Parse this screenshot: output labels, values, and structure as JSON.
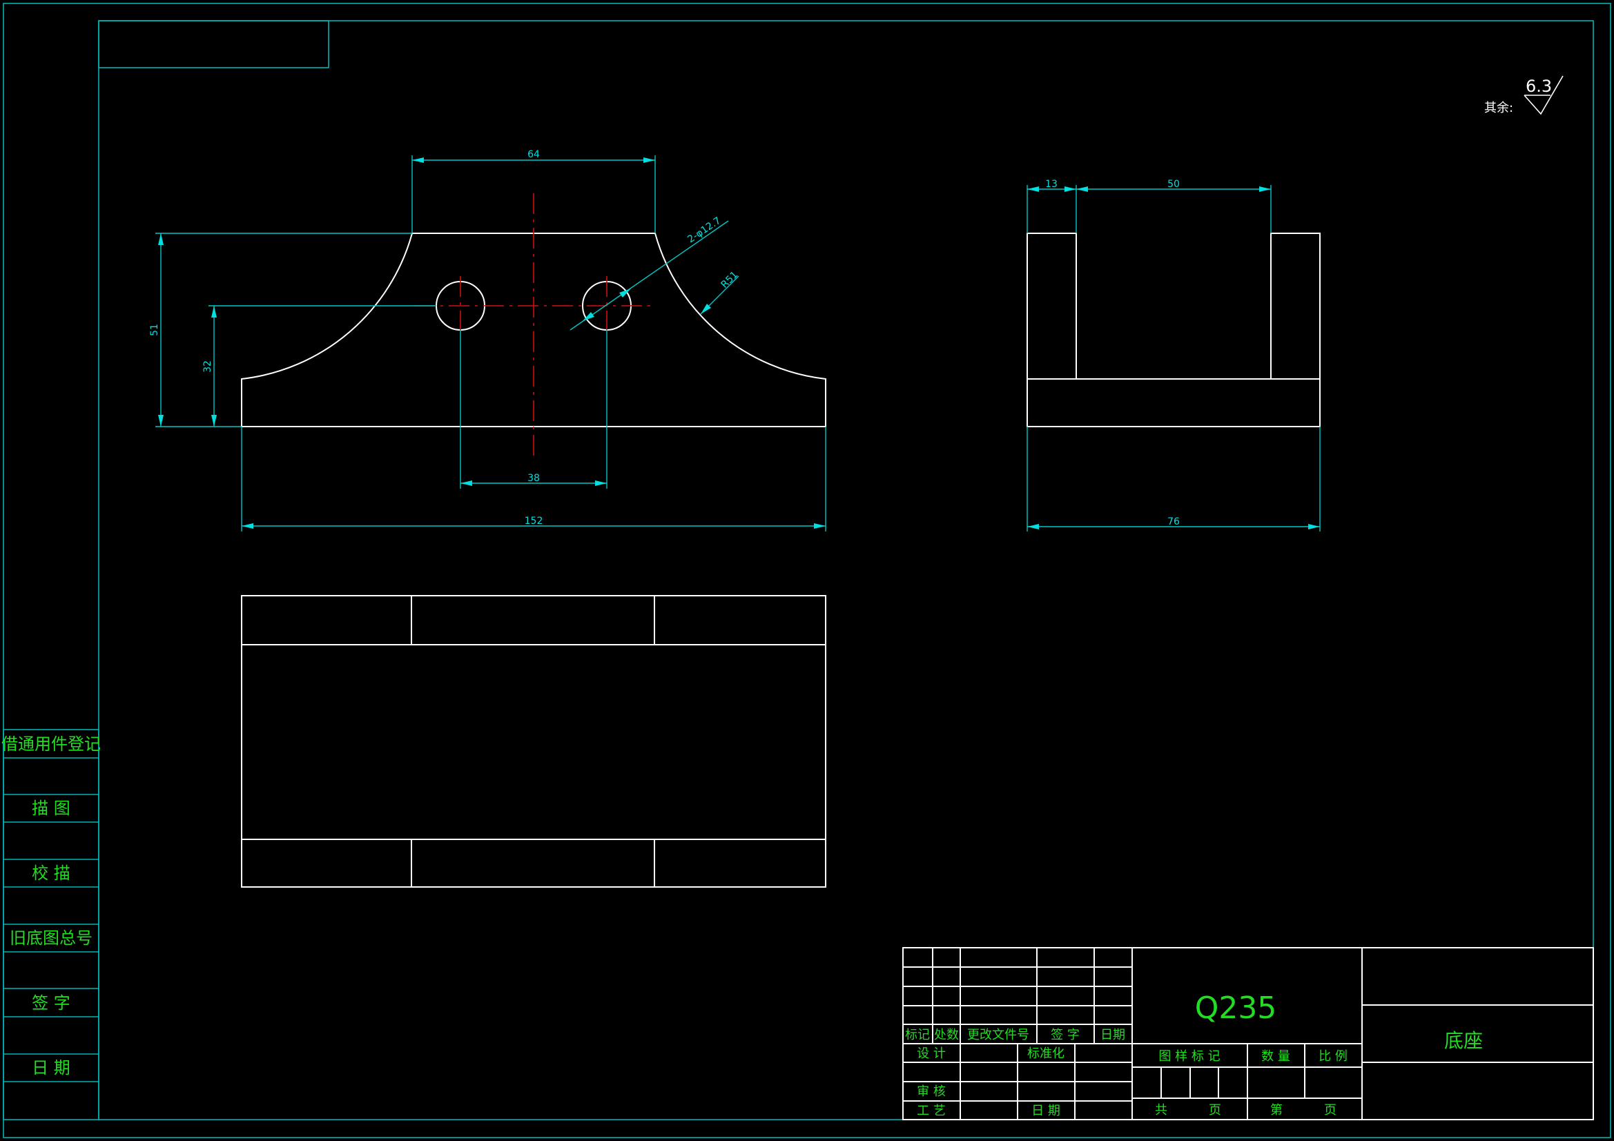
{
  "colors": {
    "background": "#000000",
    "frame": "#00b4b4",
    "part_outline": "#ffffff",
    "dimension": "#00e0e0",
    "centerline": "#d01010",
    "table_text": "#22dd22"
  },
  "dimensions": {
    "top_width": "64",
    "hole_label": "2-φ12.7",
    "arc_radius": "R51",
    "height_total": "51",
    "hole_height": "32",
    "hole_spacing": "38",
    "base_length": "152",
    "side_wall": "13",
    "side_gap": "50",
    "side_width": "76"
  },
  "roughness": {
    "prefix": "其余:",
    "value": "6.3"
  },
  "left_sidebar": [
    "借通用件登记",
    "描 图",
    "校 描",
    "旧底图总号",
    "签 字",
    "日 期"
  ],
  "title_block": {
    "rev_headers": [
      "标记",
      "处数",
      "更改文件号",
      "签 字",
      "日期"
    ],
    "design": "设 计",
    "standardization": "标准化",
    "review": "审 核",
    "process": "工 艺",
    "date": "日 期",
    "material": "Q235",
    "part_name": "底座",
    "sample_mark": "图 样 标 记",
    "quantity": "数 量",
    "scale": "比 例",
    "total_sheets": "共",
    "sheet_unit_1": "页",
    "sheet_no": "第",
    "sheet_unit_2": "页"
  }
}
